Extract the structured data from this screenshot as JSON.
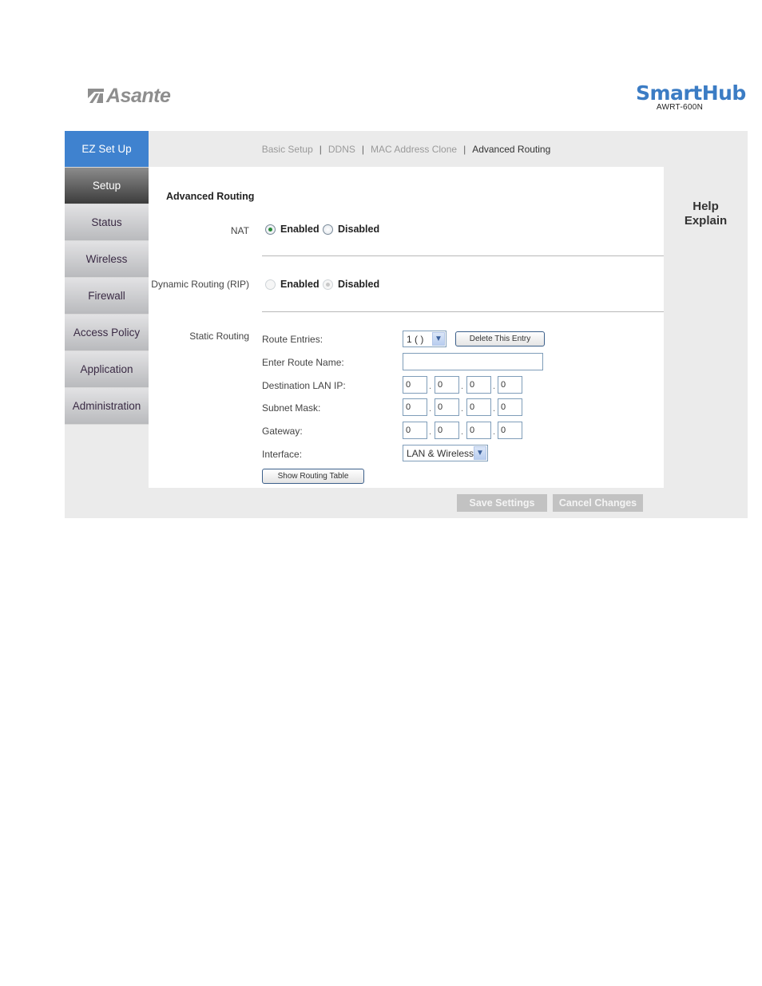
{
  "header": {
    "left_logo": "Asante",
    "right_logo": {
      "brand": "SmartHub",
      "model": "AWRT-600N"
    }
  },
  "sidebar": {
    "items": [
      {
        "label": "EZ Set Up",
        "state": "highlight"
      },
      {
        "label": "Setup",
        "state": "active"
      },
      {
        "label": "Status",
        "state": "normal"
      },
      {
        "label": "Wireless",
        "state": "normal"
      },
      {
        "label": "Firewall",
        "state": "normal"
      },
      {
        "label": "Access Policy",
        "state": "normal"
      },
      {
        "label": "Application",
        "state": "normal"
      },
      {
        "label": "Administration",
        "state": "normal"
      }
    ]
  },
  "subnav": {
    "items": [
      {
        "label": "Basic Setup"
      },
      {
        "label": "DDNS"
      },
      {
        "label": "MAC Address Clone"
      },
      {
        "label": "Advanced Routing",
        "current": true
      }
    ],
    "separator": "|"
  },
  "help": {
    "line1": "Help",
    "line2": "Explain"
  },
  "form": {
    "section_title": "Advanced Routing",
    "nat": {
      "label": "NAT",
      "options": [
        "Enabled",
        "Disabled"
      ],
      "selected": "Enabled"
    },
    "rip": {
      "label": "Dynamic Routing (RIP)",
      "options": [
        "Enabled",
        "Disabled"
      ],
      "selected": "Disabled",
      "disabled": true
    },
    "static": {
      "label": "Static Routing",
      "route_entries_label": "Route Entries:",
      "route_entries_value": "1 ( )",
      "delete_button": "Delete This Entry",
      "route_name_label": "Enter Route Name:",
      "route_name_value": "",
      "dest_ip_label": "Destination LAN IP:",
      "dest_ip": [
        "0",
        "0",
        "0",
        "0"
      ],
      "subnet_label": "Subnet Mask:",
      "subnet": [
        "0",
        "0",
        "0",
        "0"
      ],
      "gateway_label": "Gateway:",
      "gateway": [
        "0",
        "0",
        "0",
        "0"
      ],
      "interface_label": "Interface:",
      "interface_value": "LAN & Wireless",
      "show_table_button": "Show Routing Table"
    }
  },
  "actions": {
    "save": "Save Settings",
    "cancel": "Cancel Changes"
  },
  "icons": {
    "dropdown_arrow": "⌵",
    "ip_separator": "."
  }
}
